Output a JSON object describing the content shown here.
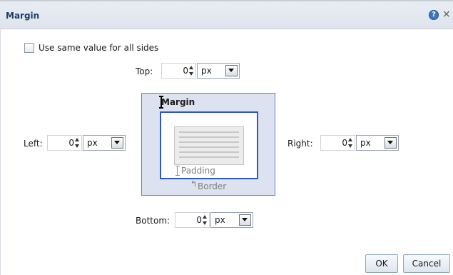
{
  "dialog": {
    "title": "Margin",
    "help_icon": "question-icon",
    "help_glyph": "?",
    "close_icon": "close-icon",
    "close_glyph": "×"
  },
  "same_value": {
    "label": "Use same value for all sides",
    "checked": false
  },
  "fields": {
    "top": {
      "label": "Top:",
      "value": "0",
      "unit": "px"
    },
    "left": {
      "label": "Left:",
      "value": "0",
      "unit": "px"
    },
    "right": {
      "label": "Right:",
      "value": "0",
      "unit": "px"
    },
    "bottom": {
      "label": "Bottom:",
      "value": "0",
      "unit": "px"
    }
  },
  "diagram": {
    "margin_label": "Margin",
    "padding_label": "Padding",
    "border_label": "Border",
    "border_arrow_glyph": "↰"
  },
  "buttons": {
    "ok": "OK",
    "cancel": "Cancel"
  },
  "colors": {
    "title_text": "#1f3f66",
    "diagram_fill": "#dde2f1",
    "border_box": "#2f57c4"
  }
}
